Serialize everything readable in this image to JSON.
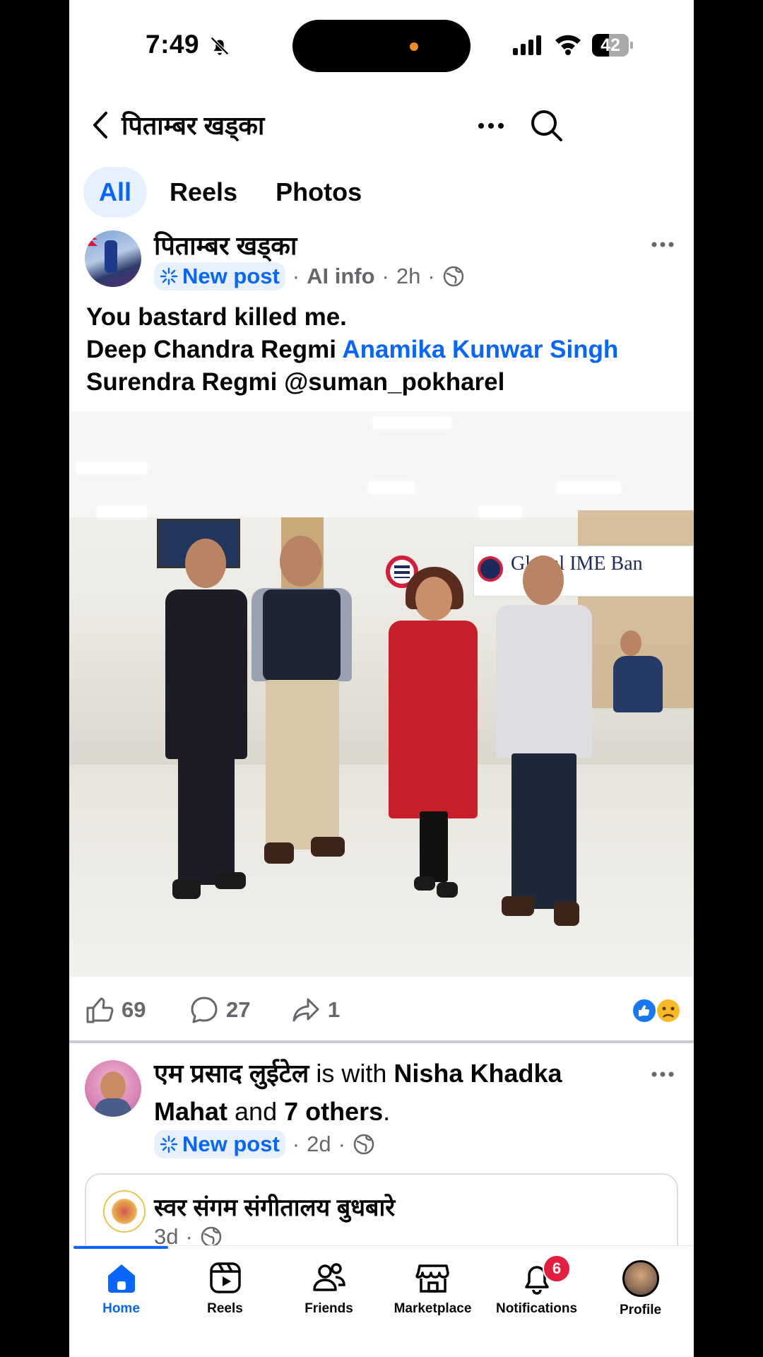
{
  "status_bar": {
    "time": "7:49",
    "battery": "42"
  },
  "header": {
    "title": "पिताम्बर खड्का"
  },
  "tabs": [
    {
      "label": "All",
      "active": true
    },
    {
      "label": "Reels",
      "active": false
    },
    {
      "label": "Photos",
      "active": false
    }
  ],
  "post1": {
    "author": "पिताम्बर खड्का",
    "badge": "New post",
    "ai_info": "AI info",
    "age": "2h",
    "text_line1": "You bastard killed me.",
    "tag1": "Deep Chandra Regmi",
    "tag2": "Anamika Kunwar Singh",
    "tag3": "Surendra Regmi @suman_pokharel",
    "photo_sign": "Global IME Ban",
    "likes": "69",
    "comments": "27",
    "shares": "1",
    "reaction_colors": {
      "like": "#1877f2",
      "sad": "#f7b928"
    }
  },
  "post2": {
    "author": "एम प्रसाद लुईटेल",
    "with_text": "is with",
    "tagged": "Nisha Khadka Mahat",
    "and_text": "and",
    "others": "7 others",
    "period": ".",
    "badge": "New post",
    "age": "2d",
    "shared": {
      "name": "स्वर संगम संगीतालय बुधबारे",
      "age": "3d"
    }
  },
  "nav": {
    "home": "Home",
    "reels": "Reels",
    "friends": "Friends",
    "marketplace": "Marketplace",
    "notifications": "Notifications",
    "notifications_badge": "6",
    "profile": "Profile"
  },
  "colors": {
    "accent": "#0866ff",
    "badge": "#e41e3f"
  }
}
